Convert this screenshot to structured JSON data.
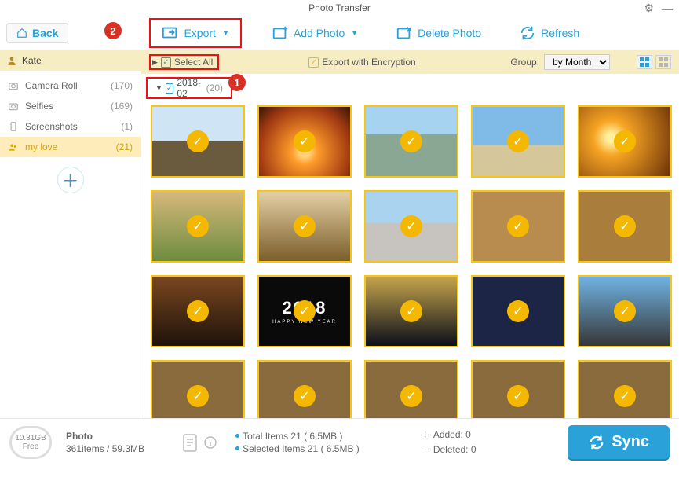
{
  "title": "Photo Transfer",
  "toolbar": {
    "back": "Back",
    "export": "Export",
    "add_photo": "Add Photo",
    "delete_photo": "Delete Photo",
    "refresh": "Refresh"
  },
  "annotations": {
    "badge1": "1",
    "badge2": "2"
  },
  "user": {
    "name": "Kate"
  },
  "sidebar": {
    "albums": [
      {
        "label": "Camera Roll",
        "count": "(170)"
      },
      {
        "label": "Selfies",
        "count": "(169)"
      },
      {
        "label": "Screenshots",
        "count": "(1)"
      },
      {
        "label": "my love",
        "count": "(21)"
      }
    ]
  },
  "content_header": {
    "select_all": "Select All",
    "encrypt_label": "Export with Encryption",
    "group_label": "Group:",
    "group_value": "by Month"
  },
  "date_group": {
    "label": "2018-02",
    "count": "(20)"
  },
  "photos": [
    "t-snow",
    "t-sunset",
    "t-city",
    "t-tower",
    "t-sunset2",
    "t-puppy1",
    "t-puppy2",
    "t-beach",
    "t-dog1",
    "t-dog2",
    "t-hands",
    "t-2018",
    "t-elf",
    "t-cartoon",
    "t-robot",
    "t-extra",
    "t-extra",
    "t-extra",
    "t-extra",
    "t-extra"
  ],
  "status": {
    "storage_value": "10.31GB",
    "storage_free": "Free",
    "photo_label": "Photo",
    "photo_detail": "361items / 59.3MB",
    "total_items": "Total Items 21 ( 6.5MB )",
    "selected_items": "Selected Items 21 ( 6.5MB )",
    "added": "Added: 0",
    "deleted": "Deleted: 0",
    "sync": "Sync"
  },
  "yr2018": {
    "yr": "2018",
    "sub": "HAPPY NEW YEAR"
  }
}
